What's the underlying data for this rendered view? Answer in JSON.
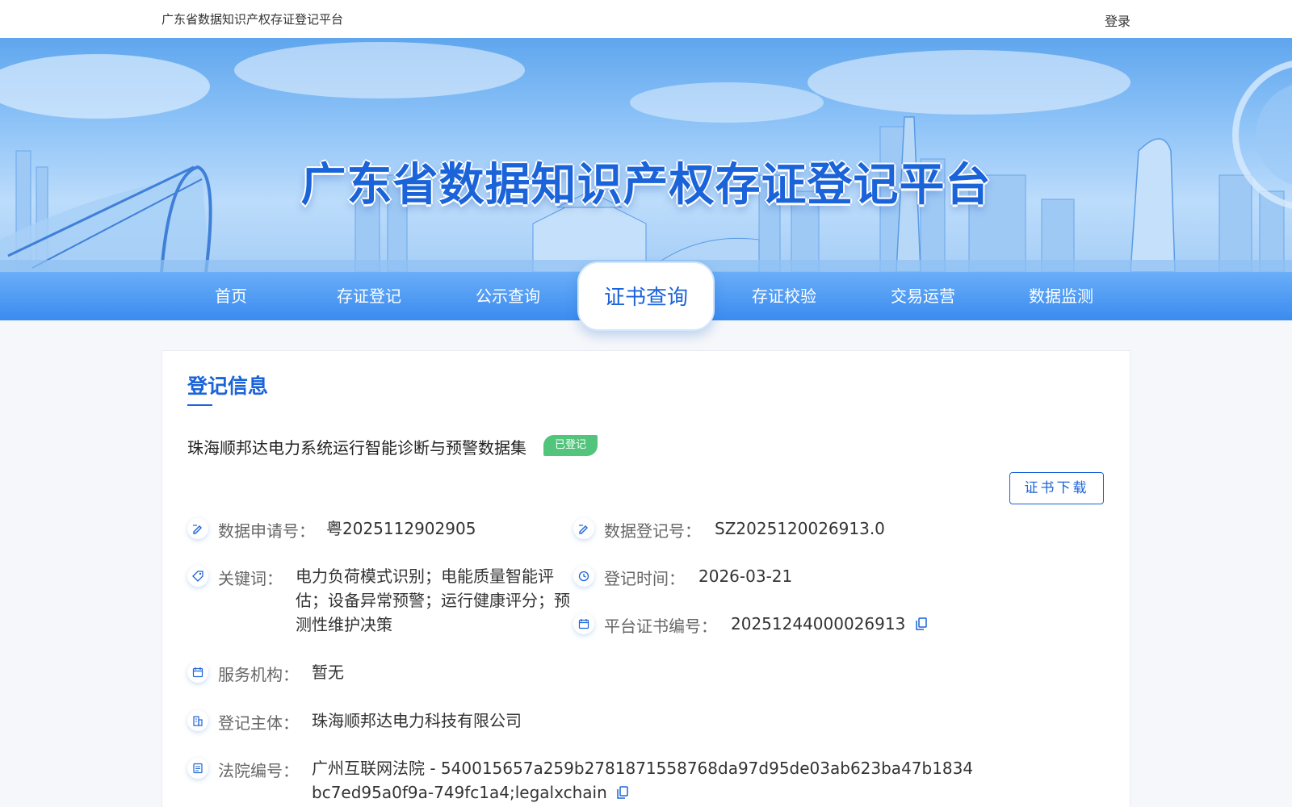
{
  "header": {
    "site_name": "广东省数据知识产权存证登记平台",
    "login_label": "登录"
  },
  "banner": {
    "title": "广东省数据知识产权存证登记平台"
  },
  "nav": {
    "items": [
      {
        "label": "首页",
        "active": false
      },
      {
        "label": "存证登记",
        "active": false
      },
      {
        "label": "公示查询",
        "active": false
      },
      {
        "label": "证书查询",
        "active": true
      },
      {
        "label": "存证校验",
        "active": false
      },
      {
        "label": "交易运营",
        "active": false
      },
      {
        "label": "数据监测",
        "active": false
      }
    ]
  },
  "colors": {
    "primary": "#1a63d9",
    "nav_gradient_top": "#6aaef8",
    "nav_gradient_bottom": "#3a8bf0",
    "status_green": "#52c47b"
  },
  "registration": {
    "section_title": "登记信息",
    "dataset_name": "珠海顺邦达电力系统运行智能诊断与预警数据集",
    "status": "已登记",
    "download_button": "证书下载",
    "fields": {
      "application_no": {
        "label": "数据申请号：",
        "value": "粤2025112902905",
        "icon": "edit-icon"
      },
      "registration_no": {
        "label": "数据登记号：",
        "value": "SZ2025120026913.0",
        "icon": "edit-icon"
      },
      "keywords": {
        "label": "关键词：",
        "value": "电力负荷模式识别；电能质量智能评估；设备异常预警；运行健康评分；预测性维护决策",
        "icon": "tag-icon"
      },
      "registration_time": {
        "label": "登记时间：",
        "value": "2026-03-21",
        "icon": "clock-icon"
      },
      "certificate_no": {
        "label": "平台证书编号：",
        "value": "20251244000026913",
        "icon": "calendar-icon"
      },
      "service_org": {
        "label": "服务机构：",
        "value": "暂无",
        "icon": "calendar-icon"
      },
      "registrant": {
        "label": "登记主体：",
        "value": "珠海顺邦达电力科技有限公司",
        "icon": "building-icon"
      },
      "court_no": {
        "label": "法院编号：",
        "value": "广州互联网法院 - 540015657a259b2781871558768da97d95de03ab623ba47b1834bc7ed95a0f9a-749fc1a4;legalxchain",
        "icon": "document-icon"
      }
    }
  }
}
